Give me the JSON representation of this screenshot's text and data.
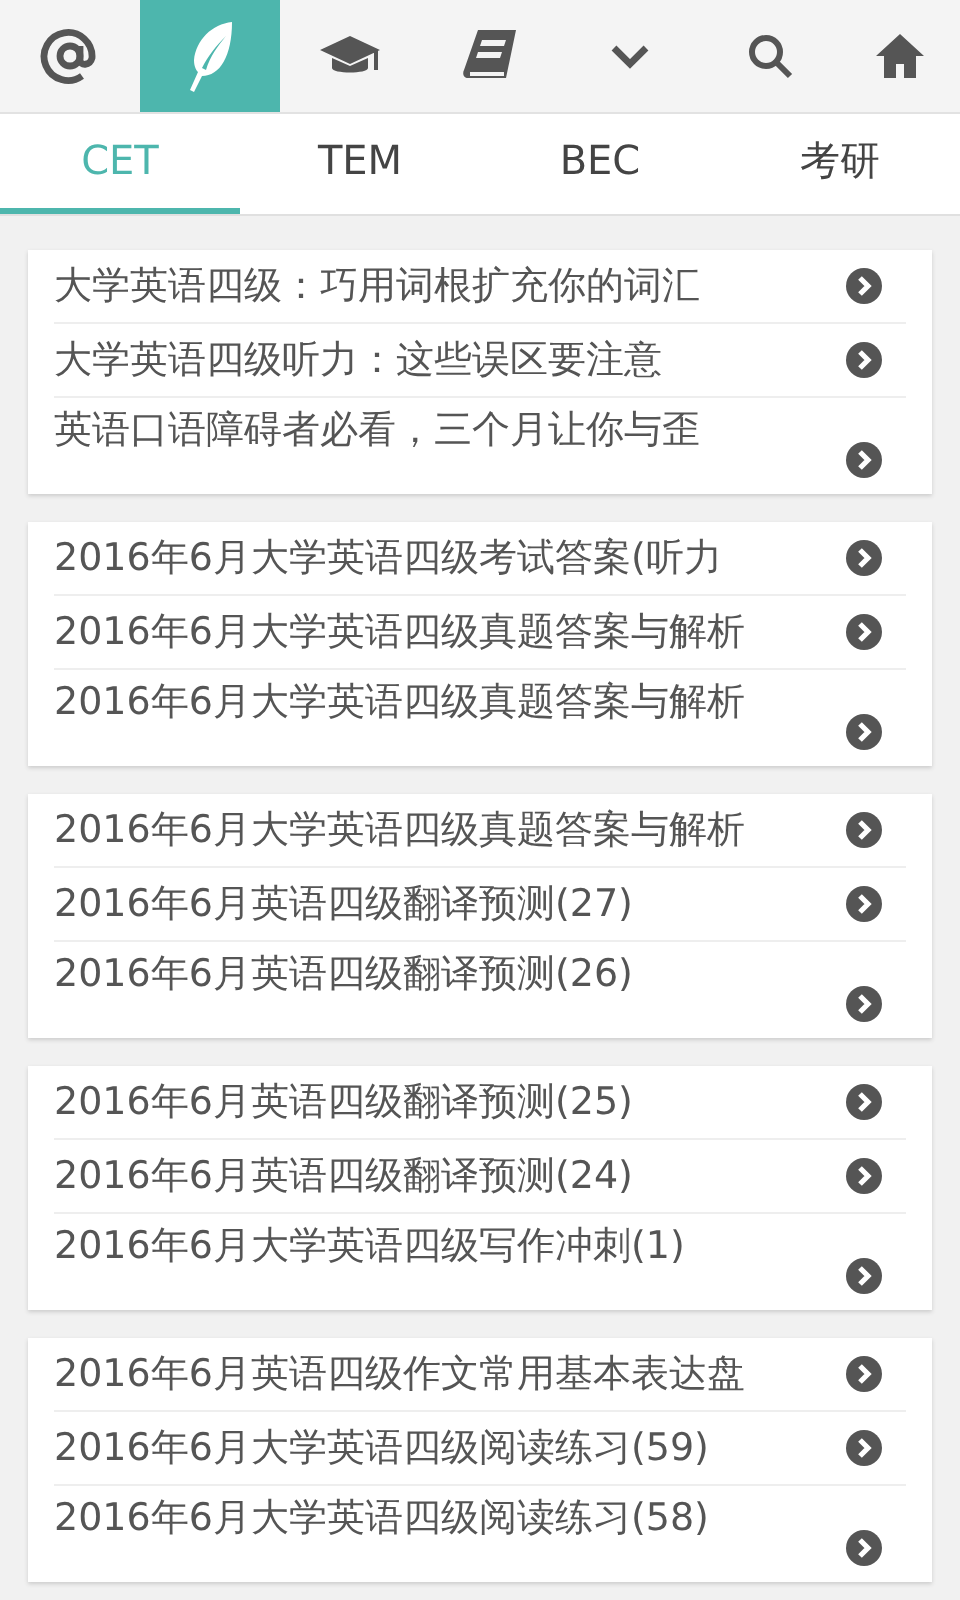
{
  "toolbar": [
    {
      "kind": "at",
      "selected": false
    },
    {
      "kind": "feather",
      "selected": true
    },
    {
      "kind": "cap",
      "selected": false
    },
    {
      "kind": "book",
      "selected": false
    },
    {
      "kind": "chevron",
      "selected": false
    },
    {
      "kind": "search",
      "selected": false
    },
    {
      "kind": "home",
      "selected": false
    }
  ],
  "tabs": [
    {
      "label": "CET",
      "selected": true
    },
    {
      "label": "TEM",
      "selected": false
    },
    {
      "label": "BEC",
      "selected": false
    },
    {
      "label": "考研",
      "selected": false
    }
  ],
  "groups": [
    {
      "items": [
        "大学英语四级：巧用词根扩充你的词汇",
        "大学英语四级听力：这些误区要注意",
        "英语口语障碍者必看，三个月让你与歪"
      ]
    },
    {
      "items": [
        "2016年6月大学英语四级考试答案(听力",
        "2016年6月大学英语四级真题答案与解析",
        "2016年6月大学英语四级真题答案与解析"
      ]
    },
    {
      "items": [
        "2016年6月大学英语四级真题答案与解析",
        "2016年6月英语四级翻译预测(27)",
        "2016年6月英语四级翻译预测(26)"
      ]
    },
    {
      "items": [
        "2016年6月英语四级翻译预测(25)",
        "2016年6月英语四级翻译预测(24)",
        "2016年6月大学英语四级写作冲刺(1)"
      ]
    },
    {
      "items": [
        "2016年6月英语四级作文常用基本表达盘",
        "2016年6月大学英语四级阅读练习(59)",
        "2016年6月大学英语四级阅读练习(58)"
      ]
    }
  ]
}
